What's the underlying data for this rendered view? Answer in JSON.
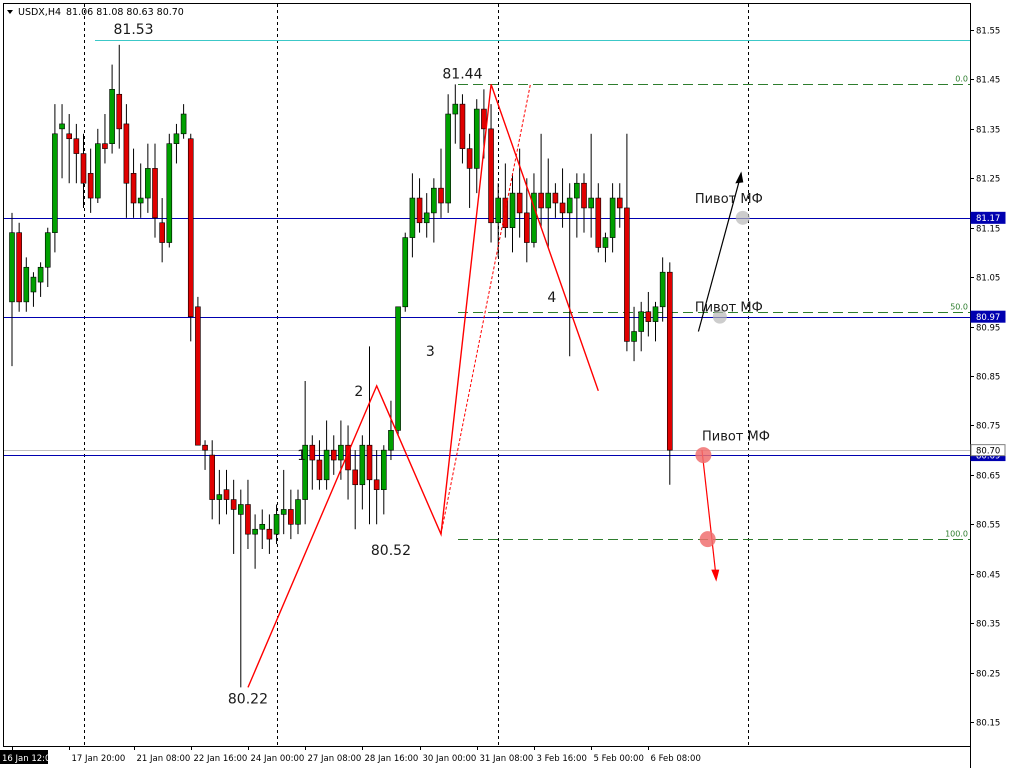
{
  "header": {
    "symbol": "USDX,H4",
    "ohlc": "81.06 81.08 80.63 80.70"
  },
  "colors": {
    "bull": "#00a000",
    "bear": "#e00000",
    "pattern": "#ff0000",
    "level_line": "#0000b0",
    "top_line": "#3cc8c8",
    "fib": "#2e7d2e",
    "price_marker": "#0000b0",
    "grid": "#000000"
  },
  "chart_data": {
    "type": "candlestick",
    "title": "",
    "ylim": [
      80.1,
      81.6
    ],
    "y_ticks": [
      81.55,
      81.45,
      81.35,
      81.25,
      81.15,
      81.05,
      80.95,
      80.85,
      80.75,
      80.65,
      80.55,
      80.45,
      80.35,
      80.25,
      80.15
    ],
    "y_tick_labels": [
      "81.55",
      "81.45",
      "81.35",
      "81.25",
      "81.15",
      "81.05",
      "80.95",
      "80.85",
      "80.75",
      "80.65",
      "80.55",
      "80.45",
      "80.35",
      "80.25",
      "80.15"
    ],
    "x_tick_labels": [
      {
        "label": "16 Jan 12:00",
        "index": 0
      },
      {
        "label": "17 Jan 20:00",
        "index": 8
      },
      {
        "label": "21 Jan 08:00",
        "index": 17
      },
      {
        "label": "22 Jan 16:00",
        "index": 25
      },
      {
        "label": "24 Jan 00:00",
        "index": 33
      },
      {
        "label": "27 Jan 08:00",
        "index": 41
      },
      {
        "label": "28 Jan 16:00",
        "index": 49
      },
      {
        "label": "30 Jan 00:00",
        "index": 57
      },
      {
        "label": "31 Jan 08:00",
        "index": 65
      },
      {
        "label": "3 Feb 16:00",
        "index": 73
      },
      {
        "label": "5 Feb 00:00",
        "index": 81
      },
      {
        "label": "6 Feb 08:00",
        "index": 89
      }
    ],
    "vertical_separators": [
      10,
      37,
      68,
      103
    ],
    "candles": [
      [
        81.0,
        81.18,
        80.87,
        81.14
      ],
      [
        81.14,
        81.16,
        80.98,
        81.0
      ],
      [
        81.0,
        81.09,
        80.98,
        81.07
      ],
      [
        81.02,
        81.06,
        80.99,
        81.05
      ],
      [
        81.04,
        81.08,
        81.01,
        81.07
      ],
      [
        81.07,
        81.15,
        81.03,
        81.14
      ],
      [
        81.14,
        81.4,
        81.1,
        81.34
      ],
      [
        81.35,
        81.4,
        81.25,
        81.36
      ],
      [
        81.34,
        81.38,
        81.24,
        81.33
      ],
      [
        81.33,
        81.36,
        81.24,
        81.3
      ],
      [
        81.3,
        81.34,
        81.19,
        81.24
      ],
      [
        81.26,
        81.31,
        81.18,
        81.21
      ],
      [
        81.21,
        81.35,
        81.2,
        81.32
      ],
      [
        81.32,
        81.38,
        81.28,
        81.31
      ],
      [
        81.32,
        81.48,
        81.3,
        81.43
      ],
      [
        81.42,
        81.52,
        81.31,
        81.35
      ],
      [
        81.36,
        81.4,
        81.17,
        81.24
      ],
      [
        81.26,
        81.31,
        81.17,
        81.2
      ],
      [
        81.2,
        81.28,
        81.17,
        81.21
      ],
      [
        81.21,
        81.32,
        81.18,
        81.27
      ],
      [
        81.27,
        81.32,
        81.13,
        81.17
      ],
      [
        81.16,
        81.21,
        81.08,
        81.12
      ],
      [
        81.12,
        81.34,
        81.11,
        81.32
      ],
      [
        81.32,
        81.36,
        81.28,
        81.34
      ],
      [
        81.34,
        81.4,
        81.33,
        81.38
      ],
      [
        81.33,
        81.34,
        80.92,
        80.97
      ],
      [
        80.99,
        81.01,
        80.71,
        80.71
      ],
      [
        80.71,
        80.72,
        80.66,
        80.7
      ],
      [
        80.69,
        80.72,
        80.56,
        80.6
      ],
      [
        80.6,
        80.66,
        80.55,
        80.61
      ],
      [
        80.62,
        80.66,
        80.57,
        80.6
      ],
      [
        80.6,
        80.64,
        80.49,
        80.58
      ],
      [
        80.57,
        80.62,
        80.22,
        80.59
      ],
      [
        80.59,
        80.64,
        80.5,
        80.53
      ],
      [
        80.53,
        80.57,
        80.46,
        80.54
      ],
      [
        80.54,
        80.58,
        80.5,
        80.55
      ],
      [
        80.54,
        80.57,
        80.49,
        80.52
      ],
      [
        80.53,
        80.59,
        80.51,
        80.57
      ],
      [
        80.57,
        80.66,
        80.53,
        80.58
      ],
      [
        80.58,
        80.62,
        80.52,
        80.55
      ],
      [
        80.55,
        80.62,
        80.53,
        80.6
      ],
      [
        80.6,
        80.84,
        80.55,
        80.71
      ],
      [
        80.71,
        80.73,
        80.62,
        80.68
      ],
      [
        80.68,
        80.72,
        80.62,
        80.64
      ],
      [
        80.64,
        80.76,
        80.62,
        80.7
      ],
      [
        80.7,
        80.73,
        80.65,
        80.68
      ],
      [
        80.68,
        80.76,
        80.64,
        80.71
      ],
      [
        80.71,
        80.75,
        80.6,
        80.66
      ],
      [
        80.66,
        80.7,
        80.54,
        80.63
      ],
      [
        80.63,
        80.73,
        80.58,
        80.71
      ],
      [
        80.71,
        80.91,
        80.55,
        80.64
      ],
      [
        80.64,
        80.7,
        80.55,
        80.62
      ],
      [
        80.62,
        80.71,
        80.57,
        80.7
      ],
      [
        80.7,
        80.8,
        80.68,
        80.74
      ],
      [
        80.74,
        80.99,
        80.73,
        80.99
      ],
      [
        80.99,
        81.14,
        80.98,
        81.13
      ],
      [
        81.13,
        81.26,
        81.09,
        81.21
      ],
      [
        81.21,
        81.25,
        81.14,
        81.16
      ],
      [
        81.16,
        81.22,
        81.13,
        81.18
      ],
      [
        81.18,
        81.25,
        81.12,
        81.23
      ],
      [
        81.23,
        81.31,
        81.17,
        81.2
      ],
      [
        81.2,
        81.42,
        81.18,
        81.38
      ],
      [
        81.38,
        81.44,
        81.32,
        81.4
      ],
      [
        81.4,
        81.42,
        81.28,
        81.31
      ],
      [
        81.31,
        81.34,
        81.19,
        81.27
      ],
      [
        81.27,
        81.41,
        81.22,
        81.39
      ],
      [
        81.39,
        81.43,
        81.29,
        81.35
      ],
      [
        81.35,
        81.4,
        81.12,
        81.16
      ],
      [
        81.16,
        81.24,
        81.09,
        81.21
      ],
      [
        81.21,
        81.28,
        81.13,
        81.15
      ],
      [
        81.15,
        81.26,
        81.1,
        81.22
      ],
      [
        81.22,
        81.31,
        81.13,
        81.18
      ],
      [
        81.18,
        81.25,
        81.08,
        81.12
      ],
      [
        81.12,
        81.26,
        81.11,
        81.22
      ],
      [
        81.22,
        81.34,
        81.15,
        81.19
      ],
      [
        81.19,
        81.29,
        81.11,
        81.22
      ],
      [
        81.22,
        81.24,
        81.17,
        81.2
      ],
      [
        81.2,
        81.27,
        81.15,
        81.18
      ],
      [
        81.18,
        81.24,
        80.89,
        81.21
      ],
      [
        81.21,
        81.26,
        81.13,
        81.24
      ],
      [
        81.24,
        81.26,
        81.14,
        81.19
      ],
      [
        81.19,
        81.34,
        81.13,
        81.21
      ],
      [
        81.21,
        81.24,
        81.1,
        81.11
      ],
      [
        81.11,
        81.14,
        81.08,
        81.13
      ],
      [
        81.13,
        81.24,
        81.1,
        81.21
      ],
      [
        81.21,
        81.24,
        81.15,
        81.19
      ],
      [
        81.19,
        81.34,
        80.9,
        80.92
      ],
      [
        80.92,
        80.99,
        80.88,
        80.94
      ],
      [
        80.94,
        81.0,
        80.9,
        80.98
      ],
      [
        80.98,
        81.02,
        80.93,
        80.96
      ],
      [
        80.96,
        81.0,
        80.92,
        80.99
      ],
      [
        80.99,
        81.09,
        80.96,
        81.06
      ],
      [
        81.06,
        81.08,
        80.63,
        80.7
      ]
    ],
    "horizontal_levels": [
      {
        "price": 81.53,
        "style": "top",
        "label": "81.53",
        "marker": ""
      },
      {
        "price": 81.17,
        "style": "blue",
        "label": "",
        "marker": "81.17"
      },
      {
        "price": 80.97,
        "style": "blue",
        "label": "",
        "marker": "80.97"
      },
      {
        "price": 80.69,
        "style": "blue",
        "label": "",
        "marker": "80.69"
      },
      {
        "price": 80.7,
        "style": "gray",
        "label": "",
        "marker": "80.70"
      }
    ],
    "fib_levels": [
      {
        "price": 81.44,
        "label": "0.0"
      },
      {
        "price": 80.98,
        "label": "50.0"
      },
      {
        "price": 80.52,
        "label": "100.0"
      }
    ],
    "price_labels": [
      {
        "text": "81.53",
        "index": 17,
        "price": 81.53
      },
      {
        "text": "81.44",
        "index": 63,
        "price": 81.44
      },
      {
        "text": "80.52",
        "index": 53,
        "price": 80.52
      },
      {
        "text": "80.22",
        "index": 33,
        "price": 80.22
      }
    ],
    "wave_numbers": [
      {
        "text": "1",
        "index": 40.5,
        "price": 80.68
      },
      {
        "text": "2",
        "index": 48.5,
        "price": 80.81
      },
      {
        "text": "3",
        "index": 58.5,
        "price": 80.89
      },
      {
        "text": "4",
        "index": 75.5,
        "price": 81.0
      }
    ],
    "pivot_labels": [
      {
        "text": "Пивот МФ",
        "index": 95.5,
        "price": 81.2
      },
      {
        "text": "Пивот МФ",
        "index": 95.5,
        "price": 80.98
      },
      {
        "text": "Пивот МФ",
        "index": 96.5,
        "price": 80.72
      }
    ]
  }
}
